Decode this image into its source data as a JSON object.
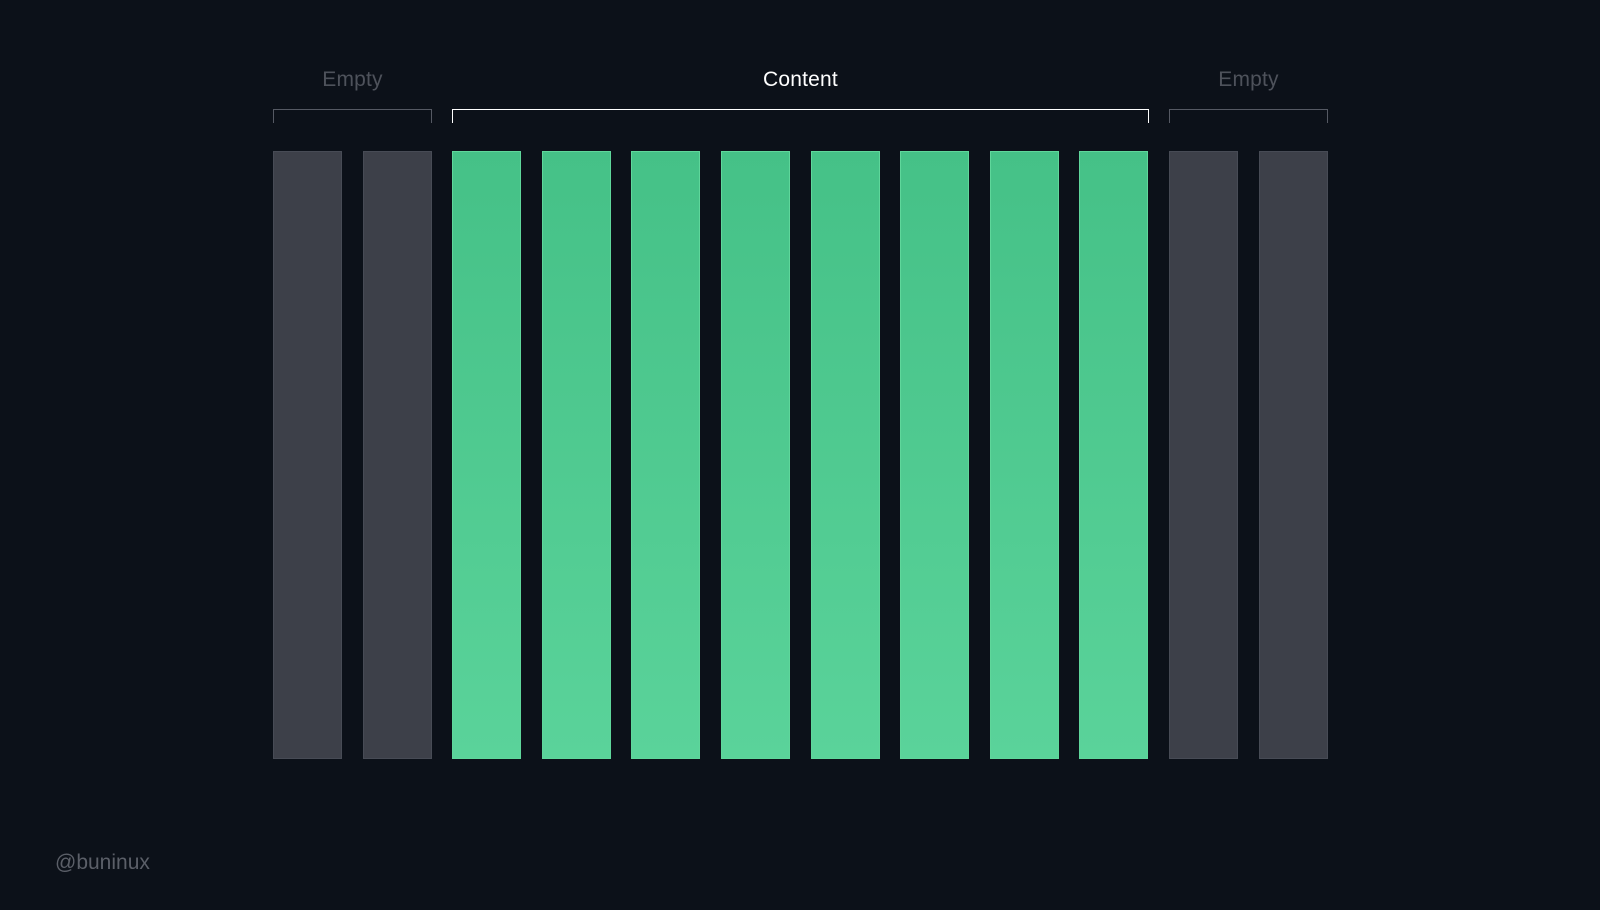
{
  "groups": {
    "empty_left": {
      "label": "Empty"
    },
    "content": {
      "label": "Content"
    },
    "empty_right": {
      "label": "Empty"
    }
  },
  "columns": [
    {
      "state": "empty"
    },
    {
      "state": "empty"
    },
    {
      "state": "filled"
    },
    {
      "state": "filled"
    },
    {
      "state": "filled"
    },
    {
      "state": "filled"
    },
    {
      "state": "filled"
    },
    {
      "state": "filled"
    },
    {
      "state": "filled"
    },
    {
      "state": "filled"
    },
    {
      "state": "empty"
    },
    {
      "state": "empty"
    }
  ],
  "watermark": "@buninux",
  "colors": {
    "background": "#0c1119",
    "empty_column": "#3d4049",
    "content_top": "#45c187",
    "content_bottom": "#5ad39a",
    "empty_label": "#4e525b",
    "content_label": "#ffffff",
    "empty_bracket": "#555963",
    "content_bracket": "#ffffff",
    "watermark": "#5b5f68"
  }
}
